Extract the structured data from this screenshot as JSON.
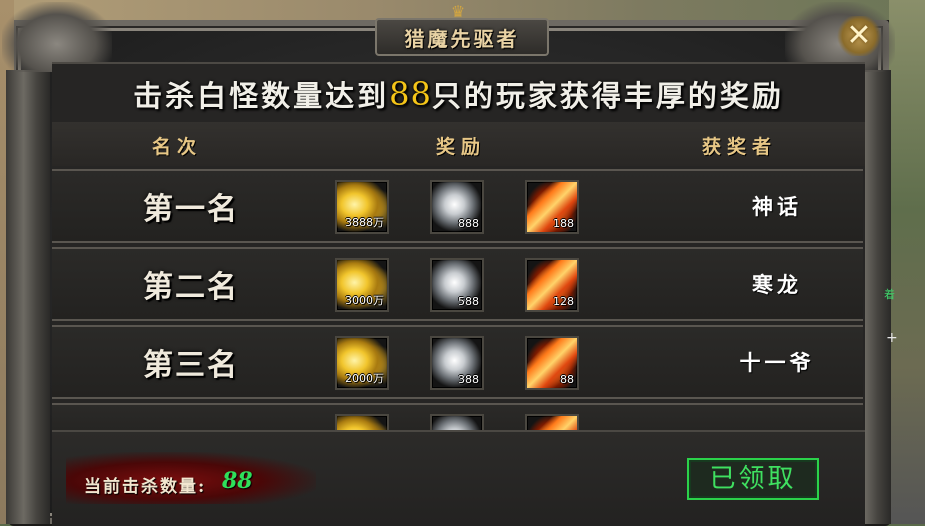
{
  "window": {
    "title": "猎魔先驱者",
    "close_symbol": "✕"
  },
  "headline": {
    "prefix": "击杀白怪数量达到",
    "count": "88",
    "suffix": "只的玩家获得丰厚的奖励"
  },
  "columns": {
    "rank": "名次",
    "reward": "奖励",
    "winner": "获奖者"
  },
  "rows": [
    {
      "rank": "第一名",
      "rewards": [
        {
          "icon": "gold-ingot-icon",
          "qty": "3888万"
        },
        {
          "icon": "silver-ore-icon",
          "qty": "888"
        },
        {
          "icon": "skill-book-icon",
          "qty": "188"
        }
      ],
      "winner": "神话"
    },
    {
      "rank": "第二名",
      "rewards": [
        {
          "icon": "gold-ingot-icon",
          "qty": "3000万"
        },
        {
          "icon": "silver-ore-icon",
          "qty": "588"
        },
        {
          "icon": "skill-book-icon",
          "qty": "128"
        }
      ],
      "winner": "寒龙"
    },
    {
      "rank": "第三名",
      "rewards": [
        {
          "icon": "gold-ingot-icon",
          "qty": "2000万"
        },
        {
          "icon": "silver-ore-icon",
          "qty": "388"
        },
        {
          "icon": "skill-book-icon",
          "qty": "88"
        }
      ],
      "winner": "十一爷"
    }
  ],
  "footer": {
    "kill_label": "当前击杀数量:",
    "kill_count": "88",
    "claim_button": "已领取"
  },
  "side": {
    "mark": "着",
    "plus": "+"
  },
  "colors": {
    "accent_gold": "#f5c518",
    "header_text": "#e7c786",
    "claim_green": "#3fe060"
  }
}
